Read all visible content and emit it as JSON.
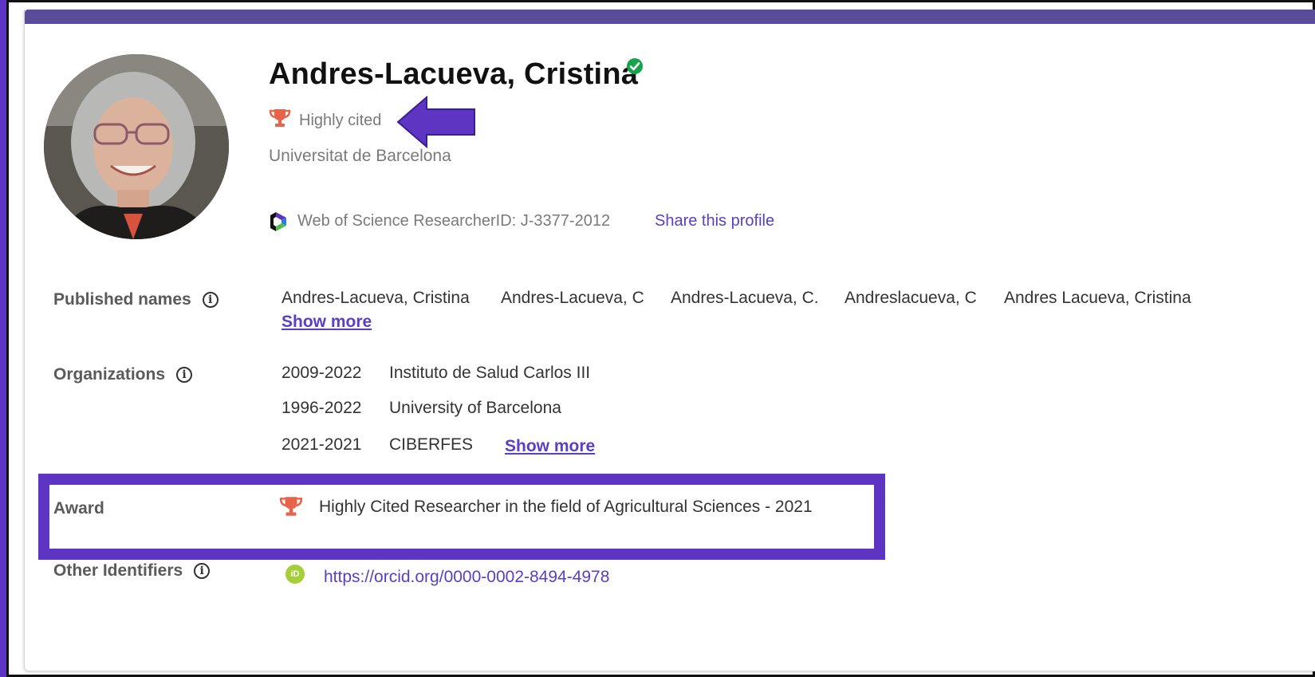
{
  "profile": {
    "name": "Andres-Lacueva, Cristina",
    "highly_cited": "Highly cited",
    "affiliation": "Universitat de Barcelona",
    "researcher_id": "Web of Science ResearcherID: J-3377-2012",
    "share": "Share this profile"
  },
  "published_names": {
    "label": "Published names",
    "names": [
      "Andres-Lacueva, Cristina",
      "Andres-Lacueva, C",
      "Andres-Lacueva, C.",
      "Andreslacueva, C",
      "Andres Lacueva, Cristina"
    ],
    "show_more": "Show more"
  },
  "organizations": {
    "label": "Organizations",
    "items": [
      {
        "years": "2009-2022",
        "name": "Instituto de Salud Carlos III"
      },
      {
        "years": "1996-2022",
        "name": "University of Barcelona"
      },
      {
        "years": "2021-2021",
        "name": "CIBERFES"
      }
    ],
    "show_more": "Show more"
  },
  "award": {
    "label": "Award",
    "text": "Highly Cited Researcher in the field of Agricultural Sciences - 2021"
  },
  "identifiers": {
    "label": "Other Identifiers",
    "orcid_badge": "iD",
    "orcid_url": "https://orcid.org/0000-0002-8494-4978"
  },
  "colors": {
    "accent": "#5e35c2",
    "topbar": "#5b4b9b",
    "trophy": "#e8634a",
    "verified": "#16a34a",
    "link": "#5a3ec8"
  },
  "icons": [
    "verified-check-icon",
    "trophy-icon",
    "info-icon",
    "wos-logo-icon",
    "orcid-icon",
    "arrow-annotation-icon"
  ]
}
